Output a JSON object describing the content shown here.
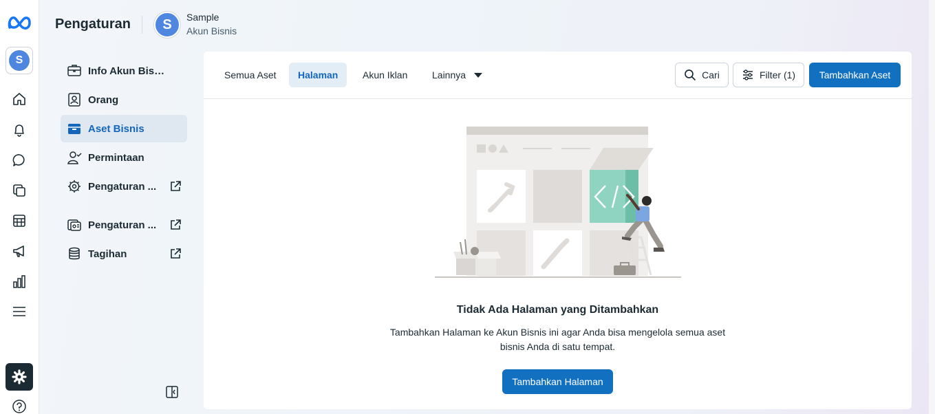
{
  "page": {
    "title": "Pengaturan"
  },
  "business": {
    "avatar_letter": "S",
    "name": "Sample",
    "subtitle": "Akun Bisnis"
  },
  "rail": {
    "account_letter": "S",
    "icons": [
      "meta-logo",
      "home-icon",
      "bell-icon",
      "chat-icon",
      "pages-icon",
      "table-icon",
      "megaphone-icon",
      "chart-icon",
      "menu-icon",
      "gear-icon",
      "help-icon"
    ]
  },
  "sidebar": {
    "items": [
      {
        "label": "Info Akun Bisnis",
        "icon": "business-info-icon",
        "external": false,
        "active": false
      },
      {
        "label": "Orang",
        "icon": "people-icon",
        "external": false,
        "active": false
      },
      {
        "label": "Aset Bisnis",
        "icon": "briefcase-icon",
        "external": false,
        "active": true
      },
      {
        "label": "Permintaan",
        "icon": "requests-icon",
        "external": false,
        "active": false
      },
      {
        "label": "Pengaturan ...",
        "icon": "gear-icon",
        "external": true,
        "active": false
      },
      {
        "label": "Pengaturan ...",
        "icon": "brand-settings-icon",
        "external": true,
        "active": false
      },
      {
        "label": "Tagihan",
        "icon": "billing-icon",
        "external": true,
        "active": false
      }
    ]
  },
  "tabs": [
    {
      "label": "Semua Aset",
      "active": false
    },
    {
      "label": "Halaman",
      "active": true
    },
    {
      "label": "Akun Iklan",
      "active": false
    },
    {
      "label": "Lainnya",
      "active": false
    }
  ],
  "toolbar": {
    "search_label": "Cari",
    "filter_label": "Filter (1)",
    "add_label": "Tambahkan Aset"
  },
  "empty_state": {
    "title": "Tidak Ada Halaman yang Ditambahkan",
    "description": "Tambahkan Halaman ke Akun Bisnis ini agar Anda bisa mengelola semua aset bisnis Anda di satu tempat.",
    "cta_label": "Tambahkan Halaman"
  },
  "colors": {
    "primary": "#1270c1",
    "active_text": "#1466ba",
    "active_bg": "#dfe8f1",
    "avatar": "#4e86e0",
    "illustration_accent": "#8fd4c1"
  }
}
